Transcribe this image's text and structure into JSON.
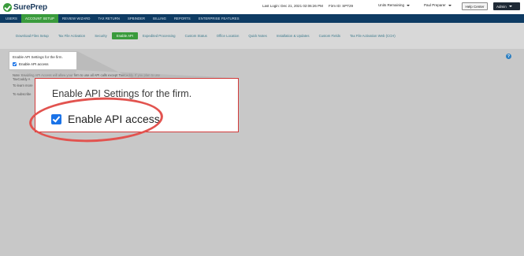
{
  "brand": {
    "name": "SurePrep"
  },
  "header": {
    "last_login_label": "Last Login:",
    "last_login_value": "Dec 21, 2021 02:06:26 PM",
    "firm_id_label": "Firm ID:",
    "firm_id_value": "SPT29",
    "units_label": "Units Remaining",
    "user_label": "Paul Preparer",
    "help_label": "Help Center",
    "admin_label": "Admin"
  },
  "main_nav": [
    {
      "label": "USERS"
    },
    {
      "label": "ACCOUNT SETUP"
    },
    {
      "label": "REVIEW WIZARD"
    },
    {
      "label": "TAX RETURN"
    },
    {
      "label": "SPBINDER"
    },
    {
      "label": "BILLING"
    },
    {
      "label": "REPORTS"
    },
    {
      "label": "ENTERPRISE FEATURES"
    }
  ],
  "sub_nav": [
    {
      "label": "Download Files Setup"
    },
    {
      "label": "Tax File Activation"
    },
    {
      "label": "Security"
    },
    {
      "label": "Enable API"
    },
    {
      "label": "Expedited Processing"
    },
    {
      "label": "Custom Status"
    },
    {
      "label": "Office Location"
    },
    {
      "label": "Quick Notes"
    },
    {
      "label": "Installation & Updates"
    },
    {
      "label": "Custom Fields"
    },
    {
      "label": "Tax File Activation Web (CCH)"
    }
  ],
  "panel": {
    "title": "Enable API Settings for the firm.",
    "checkbox_label": "Enable API access",
    "checkbox_checked": true
  },
  "notes": {
    "line1": "Note: Enabling API Access will allow your firm to use all API calls except TaxCaddy. If you plan to use",
    "line2": "TaxCaddy A",
    "line3": "To learn more",
    "line4": "To subscribe"
  },
  "help_icon": "question-icon",
  "colors": {
    "nav_bg": "#0e3b63",
    "accent_green": "#3a9b3c",
    "highlight_red": "#e2534f",
    "checkbox_blue": "#1a73e8"
  }
}
